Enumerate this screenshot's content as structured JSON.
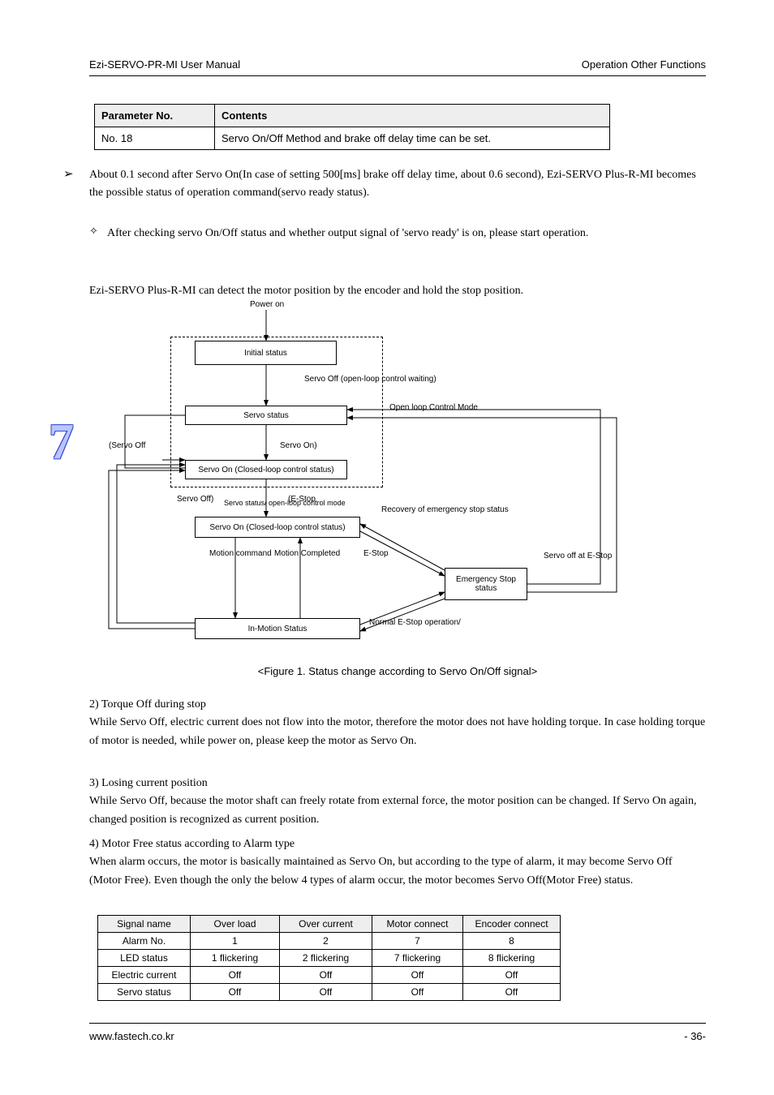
{
  "header": {
    "left": "Ezi-SERVO-PR-MI User Manual",
    "right": "Operation Other Functions"
  },
  "table1": {
    "h1": "Parameter No.",
    "h2": "Contents",
    "r1c1": "No. 18",
    "r1c2": "Servo On/Off Method and brake off delay time can be set."
  },
  "p1": "About 0.1 second after Servo On(In case of setting 500[ms] brake off delay time, about 0.6 second), Ezi-SERVO Plus-R-MI becomes the possible status of operation command(servo ready status).",
  "p2": "After checking servo On/Off status and whether output signal of 'servo ready' is on, please start operation.",
  "p3": "Ezi-SERVO Plus-R-MI can detect the motor position by the encoder and hold the stop position.",
  "flow": {
    "power_on": "Power on",
    "init_status": "Initial status",
    "servo_off_open": "Servo Off (open-loop control waiting)",
    "servo_status": "Servo status",
    "open_loop_mode": "Open loop Control Mode",
    "arrow_servo_on": "Servo On)",
    "arrow_servo_off": "(Servo Off",
    "note_left": "Servo Off)",
    "note_estop_paren": "(E-Stop",
    "servo_on_closed": "Servo On (Closed-loop control status)",
    "motion_command": "Motion command",
    "recovery": "Recovery of emergency stop status",
    "in_motion": "In-Motion Status",
    "emergency_stop": "Emergency Stop status",
    "note1": "Motion command",
    "note2": "Motion Completed",
    "note3": "E-Stop",
    "note4": "Normal E-Stop operation/",
    "note5": "Servo off at E-Stop",
    "note6": "Servo status/ open-loop control mode"
  },
  "caption": "<Figure 1. Status change according to Servo On/Off signal>",
  "p4_h": "2) Torque Off during stop",
  "p4": "While Servo Off, electric current does not flow into the motor, therefore the motor does not have holding torque. In case holding torque of motor is needed, while power on, please keep the motor as Servo On.",
  "p5_h": "3) Losing current position",
  "p5": "While Servo Off, because the motor shaft can freely rotate from external force, the motor position",
  "t2_caption_before": "can be changed. If Servo On again,",
  "t2_caption_after": "changed position is recognized as current position.",
  "table2": {
    "c1": "Signal name",
    "c2": "Over load",
    "c3": "Over current",
    "c4": "Motor connect",
    "c5": "Encoder connect",
    "r1": "Alarm No.",
    "r1v": [
      "1",
      "2",
      "7",
      "8"
    ],
    "r2": "LED status",
    "r2v": [
      "1 flickering",
      "2 flickering",
      "7 flickering",
      "8 flickering"
    ],
    "r3": "Electric current",
    "r3v": [
      "Off",
      "Off",
      "Off",
      "Off"
    ],
    "r4": "Servo status",
    "r4v": [
      "Off",
      "Off",
      "Off",
      "Off"
    ]
  },
  "p6_h": "4) Motor Free status according to Alarm type",
  "p6": "When alarm occurs, the motor is basically maintained as Servo On, but according to the type of alarm, it may become Servo Off (Motor Free). Even though the only the below 4 types of alarm occur, the motor becomes Servo Off(Motor Free) status.",
  "footer": {
    "left": "www.fastech.co.kr",
    "right": "- 36-"
  }
}
